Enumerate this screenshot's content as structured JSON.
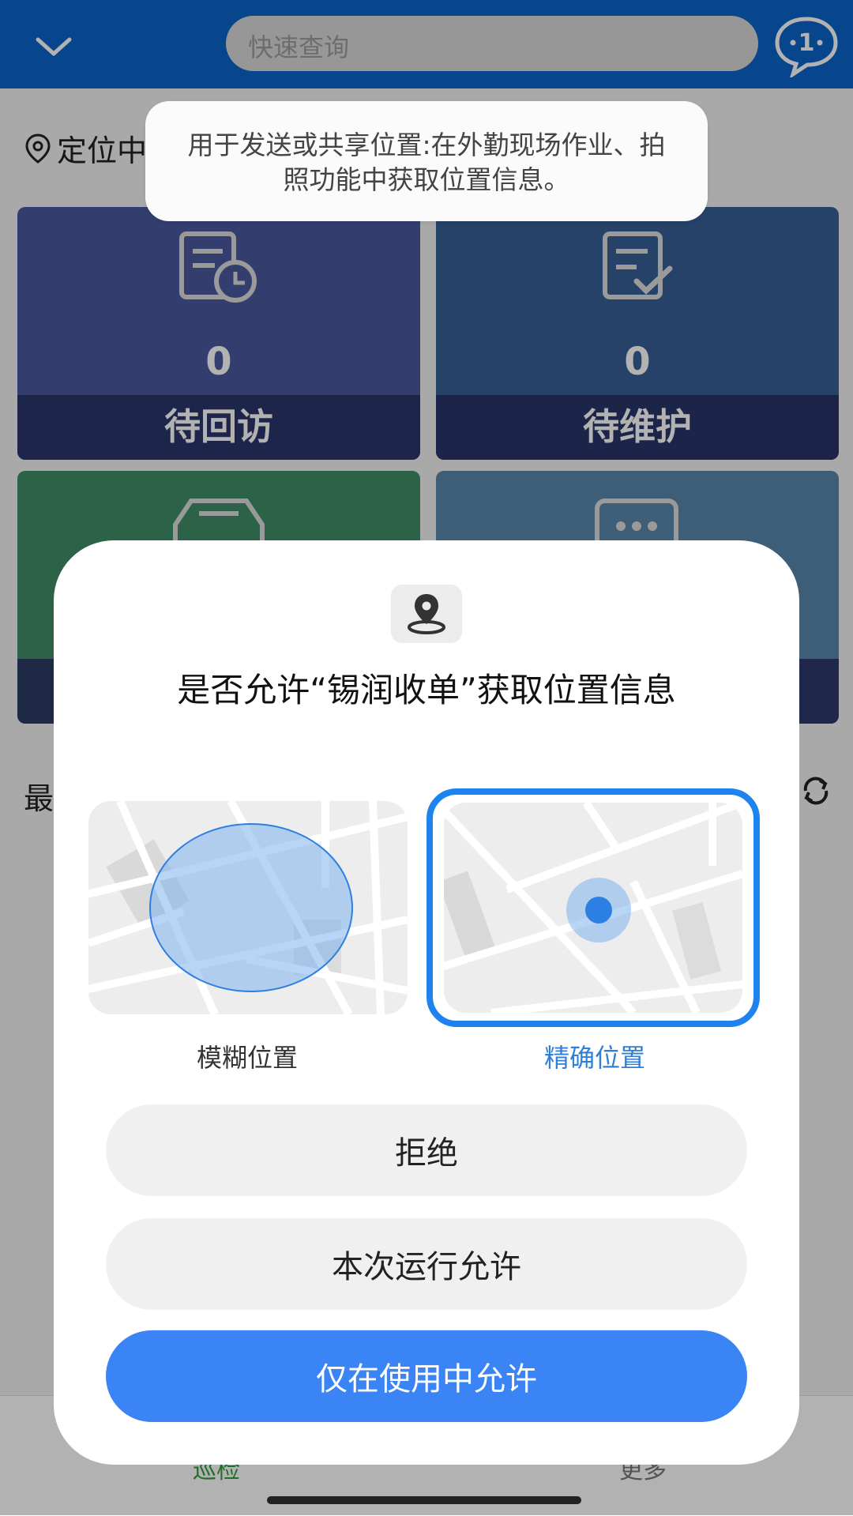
{
  "header": {
    "search_placeholder": "快速查询",
    "message_badge": "1"
  },
  "location_status": "定位中",
  "tiles": [
    {
      "count": "0",
      "label": "待回访",
      "color": "#4a5aa0"
    },
    {
      "count": "0",
      "label": "待维护",
      "color": "#375f95"
    },
    {
      "color": "#3f8f67"
    },
    {
      "color": "#5a86aa"
    }
  ],
  "recent_label": "最",
  "bottom_nav": {
    "left": "巡检",
    "right": "更多"
  },
  "tooltip": "用于发送或共享位置:在外勤现场作业、拍照功能中获取位置信息。",
  "dialog": {
    "title": "是否允许“锡润收单”获取位置信息",
    "option_approx": "模糊位置",
    "option_precise": "精确位置",
    "selected": "精确位置",
    "deny": "拒绝",
    "allow_once": "本次运行允许",
    "allow_while_using": "仅在使用中允许",
    "accent_color": "#3a84f5"
  }
}
